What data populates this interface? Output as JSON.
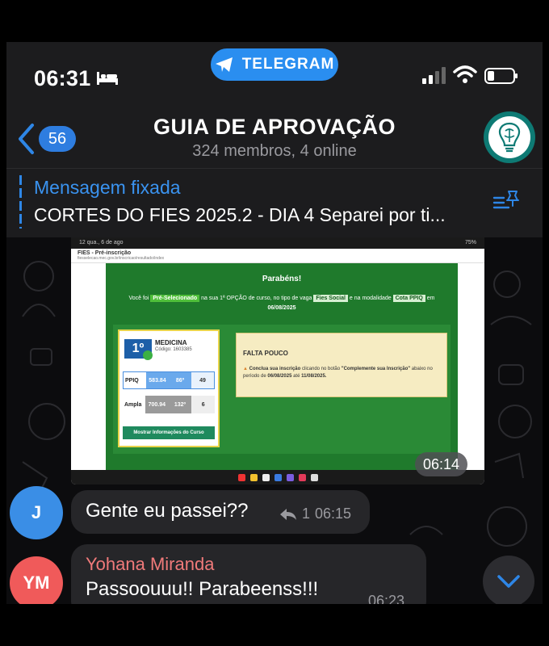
{
  "status_bar": {
    "time": "06:31"
  },
  "app_badge": {
    "label": "TELEGRAM"
  },
  "chat_header": {
    "back_count": "56",
    "title": "GUIA DE APROVAÇÃO",
    "subtitle": "324 membros, 4 online"
  },
  "pinned": {
    "title": "Mensagem fixada",
    "text": "CORTES DO FIES 2025.2 - DIA 4 Separei por ti..."
  },
  "media": {
    "status_left": "12  qua., 6 de ago",
    "status_right": "75%",
    "tab_title": "FIES - Pré-inscrição",
    "url": "fiesselecao.mec.gov.br/inscricao/resultado/index",
    "heading": "Parabéns!",
    "line_a": "Você foi",
    "badge_pre": "Pré-Selecionado",
    "line_b": "na sua 1ª OPÇÃO de curso, no tipo de vaga",
    "badge_fies": "Fies Social",
    "line_c": "e na modalidade",
    "badge_cota": "Cota PPIQ",
    "line_d": "em",
    "date": "06/08/2025",
    "rank": "1º",
    "course": "MEDICINA",
    "code": "Código: 1603385",
    "row1_label": "PPIQ",
    "row1_score": "583.84",
    "row1_pos": "86º",
    "row1_vagas": "49",
    "row2_label": "Ampla",
    "row2_score": "700.94",
    "row2_pos": "132º",
    "row2_vagas": "6",
    "button": "Mostrar Informações do Curso",
    "falta_title": "FALTA POUCO",
    "falta_body_1": "Conclua sua inscrição",
    "falta_body_2": "clicando no botão",
    "falta_body_3": "\"Complemente sua Inscrição\"",
    "falta_body_4": "abaixo no período de",
    "falta_start": "06/08/2025",
    "falta_sep": "até",
    "falta_end": "11/08/2025.",
    "time": "06:14"
  },
  "messages": [
    {
      "avatar": "J",
      "text": "Gente eu passei??",
      "replies": "1",
      "time": "06:15",
      "avatar_color": "#3a8ee6"
    },
    {
      "avatar": "YM",
      "name": "Yohana Miranda",
      "text": "Passoouuu!! Parabeenss!!!",
      "time": "06:23",
      "avatar_color": "#f05a5a"
    }
  ]
}
